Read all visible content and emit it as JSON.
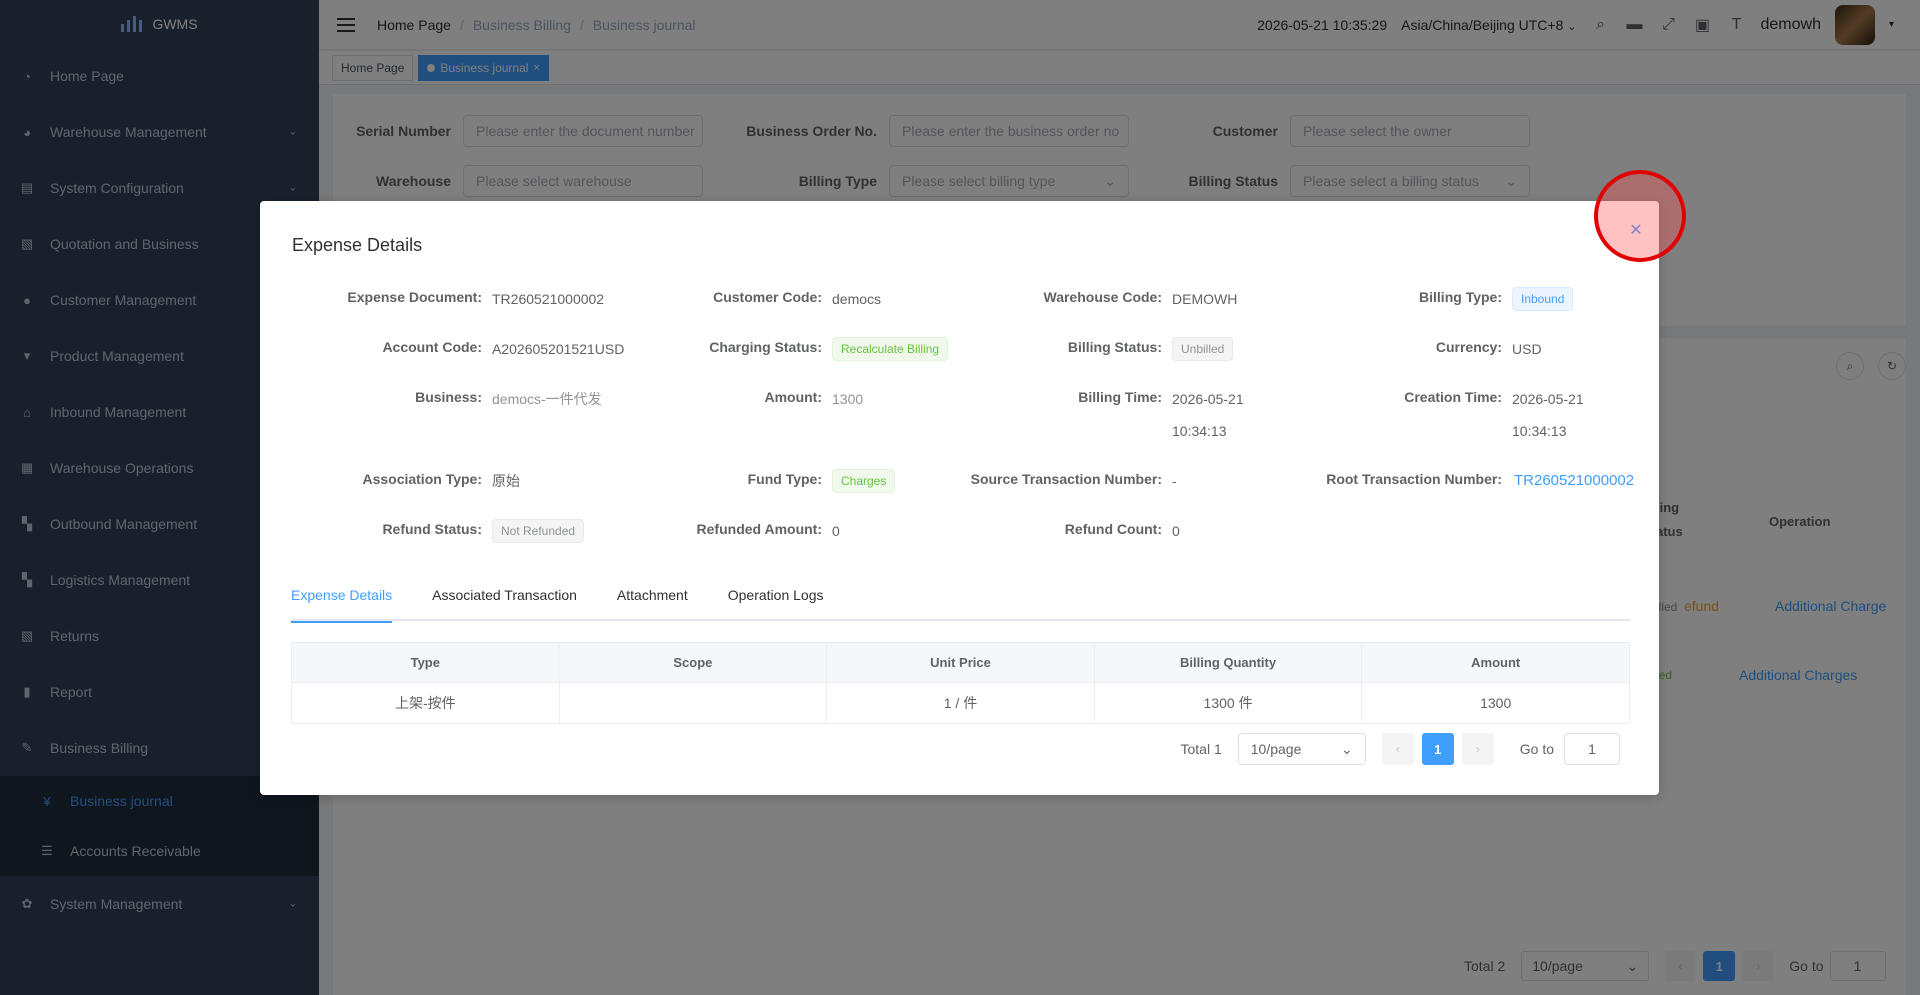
{
  "app": {
    "logo_text": "GWMS"
  },
  "sidebar": {
    "items": [
      {
        "label": "Home Page",
        "icon": "dashboard-icon"
      },
      {
        "label": "Warehouse Management",
        "icon": "warehouse-icon"
      },
      {
        "label": "System Configuration",
        "icon": "config-icon"
      },
      {
        "label": "Quotation and Business",
        "icon": "quotation-icon"
      },
      {
        "label": "Customer Management",
        "icon": "user-icon"
      },
      {
        "label": "Product Management",
        "icon": "cart-icon"
      },
      {
        "label": "Inbound Management",
        "icon": "inbound-icon"
      },
      {
        "label": "Warehouse Operations",
        "icon": "grid-icon"
      },
      {
        "label": "Outbound Management",
        "icon": "apps-icon"
      },
      {
        "label": "Logistics Management",
        "icon": "apps-icon"
      },
      {
        "label": "Returns",
        "icon": "returns-icon"
      },
      {
        "label": "Report",
        "icon": "chart-icon"
      },
      {
        "label": "Business Billing",
        "icon": "billing-icon"
      }
    ],
    "sub_items": [
      {
        "label": "Business journal",
        "icon": "yen-icon"
      },
      {
        "label": "Accounts Receivable",
        "icon": "list-icon"
      }
    ],
    "bottom_item": {
      "label": "System Management",
      "icon": "gear-icon"
    }
  },
  "header": {
    "breadcrumb": [
      "Home Page",
      "Business Billing",
      "Business journal"
    ],
    "datetime": "2026-05-21 10:35:29",
    "timezone": "Asia/China/Beijing UTC+8",
    "username": "demowh"
  },
  "tags": {
    "home": "Home Page",
    "active": "Business journal"
  },
  "search": {
    "serial_number_label": "Serial Number",
    "serial_number_placeholder": "Please enter the document number",
    "business_order_label": "Business Order No.",
    "business_order_placeholder": "Please enter the business order no",
    "customer_label": "Customer",
    "customer_placeholder": "Please select the owner",
    "warehouse_label": "Warehouse",
    "warehouse_placeholder": "Please select warehouse",
    "billing_type_label": "Billing Type",
    "billing_type_placeholder": "Please select billing type",
    "billing_status_label": "Billing Status",
    "billing_status_placeholder": "Please select a billing status"
  },
  "background_table": {
    "col_status_partial_1": "ling",
    "col_status_partial_2": "atus",
    "col_operation": "Operation",
    "row1_status_partial": "illed",
    "row1_refund_partial": "efund",
    "row1_action": "Additional Charge",
    "row2_status_partial": "led",
    "row2_action": "Additional Charges",
    "pager_total": "Total 2",
    "pager_size": "10/page",
    "pager_page": "1",
    "pager_goto": "Go to",
    "pager_goto_value": "1"
  },
  "dialog": {
    "title": "Expense Details",
    "fields": {
      "expense_document_label": "Expense Document:",
      "expense_document": "TR260521000002",
      "customer_code_label": "Customer Code:",
      "customer_code": "democs",
      "warehouse_code_label": "Warehouse Code:",
      "warehouse_code": "DEMOWH",
      "billing_type_label": "Billing Type:",
      "billing_type": "Inbound",
      "account_code_label": "Account Code:",
      "account_code": "A202605201521USD",
      "charging_status_label": "Charging Status:",
      "charging_status": "Recalculate Billing",
      "billing_status_label": "Billing Status:",
      "billing_status": "Unbilled",
      "currency_label": "Currency:",
      "currency": "USD",
      "business_label": "Business:",
      "business": "democs-一件代发",
      "amount_label": "Amount:",
      "amount": "1300",
      "billing_time_label": "Billing Time:",
      "billing_time_date": "2026-05-21",
      "billing_time_clock": "10:34:13",
      "creation_time_label": "Creation Time:",
      "creation_time_date": "2026-05-21",
      "creation_time_clock": "10:34:13",
      "association_type_label": "Association Type:",
      "association_type": "原始",
      "fund_type_label": "Fund Type:",
      "fund_type": "Charges",
      "source_txn_label": "Source Transaction Number:",
      "source_txn": "-",
      "root_txn_label": "Root Transaction Number:",
      "root_txn": "TR260521000002",
      "refund_status_label": "Refund Status:",
      "refund_status": "Not Refunded",
      "refunded_amount_label": "Refunded Amount:",
      "refunded_amount": "0",
      "refund_count_label": "Refund Count:",
      "refund_count": "0"
    },
    "tabs": [
      "Expense Details",
      "Associated Transaction",
      "Attachment",
      "Operation Logs"
    ],
    "table": {
      "headers": [
        "Type",
        "Scope",
        "Unit Price",
        "Billing Quantity",
        "Amount"
      ],
      "rows": [
        [
          "上架-按件",
          "",
          "1 / 件",
          "1300 件",
          "1300"
        ]
      ]
    },
    "pager": {
      "total": "Total 1",
      "size": "10/page",
      "page": "1",
      "goto": "Go to",
      "goto_value": "1"
    }
  },
  "colors": {
    "sidebar_bg": "#304156",
    "accent": "#409eff",
    "mask": "rgba(0,0,0,0.5)"
  }
}
